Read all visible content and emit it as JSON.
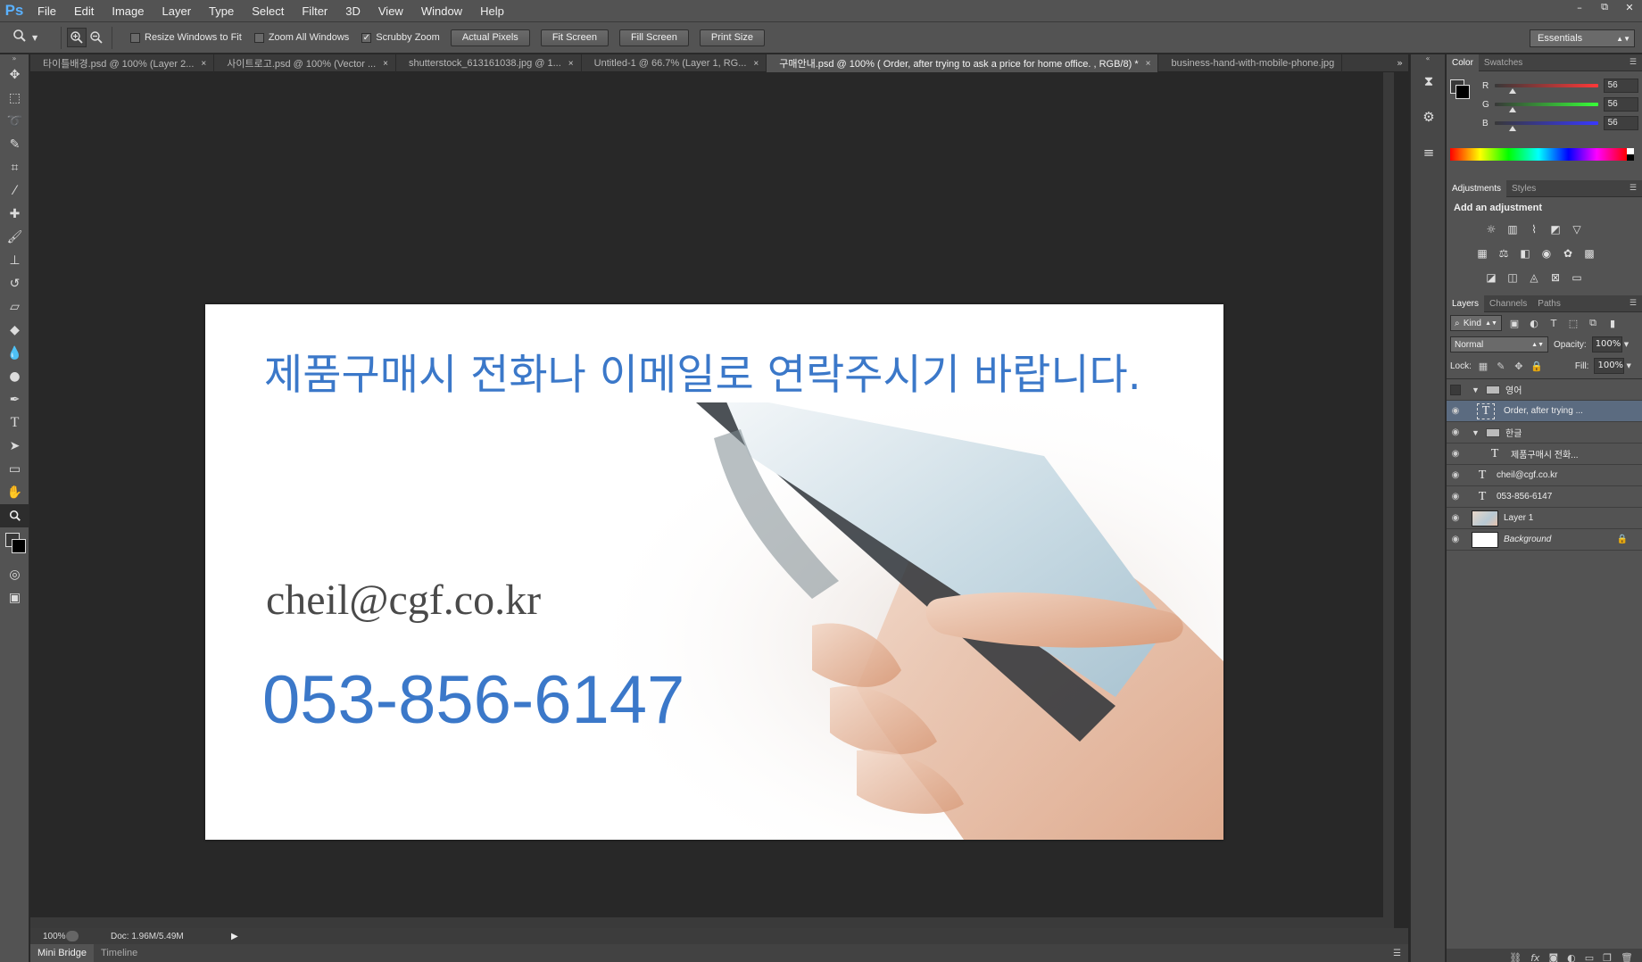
{
  "app": {
    "logo": "Ps"
  },
  "menu": [
    "File",
    "Edit",
    "Image",
    "Layer",
    "Type",
    "Select",
    "Filter",
    "3D",
    "View",
    "Window",
    "Help"
  ],
  "window_controls": [
    "–",
    "⧉",
    "✕"
  ],
  "options": {
    "resize_windows": "Resize Windows to Fit",
    "zoom_all_windows": "Zoom All Windows",
    "scrubby_zoom": "Scrubby Zoom",
    "scrubby_checked": "✓",
    "actual_pixels": "Actual Pixels",
    "fit_screen": "Fit Screen",
    "fill_screen": "Fill Screen",
    "print_size": "Print Size",
    "workspace": "Essentials"
  },
  "tabs": [
    {
      "label": "타이틀배경.psd @ 100% (Layer 2...",
      "close": "×"
    },
    {
      "label": "사이트로고.psd @ 100% (Vector ...",
      "close": "×"
    },
    {
      "label": "shutterstock_613161038.jpg @ 1...",
      "close": "×"
    },
    {
      "label": "Untitled-1 @ 66.7% (Layer 1, RG...",
      "close": "×"
    },
    {
      "label": "구매안내.psd @ 100% ( Order, after trying to ask a price for home office. , RGB/8) *",
      "close": "×"
    },
    {
      "label": "business-hand-with-mobile-phone.jpg",
      "close": ""
    }
  ],
  "tab_overflow": "»",
  "document": {
    "headline": "제품구매시 전화나 이메일로 연락주시기 바랍니다.",
    "email": "cheil@cgf.co.kr",
    "phone": "053-856-6147"
  },
  "status": {
    "zoom": "100%",
    "doc_info": "Doc: 1.96M/5.49M",
    "arrow": "▶"
  },
  "bottom_tabs": [
    "Mini Bridge",
    "Timeline"
  ],
  "color_panel": {
    "tabs": [
      "Color",
      "Swatches"
    ],
    "r_label": "R",
    "g_label": "G",
    "b_label": "B",
    "r": "56",
    "g": "56",
    "b": "56"
  },
  "adjustments": {
    "tabs": [
      "Adjustments",
      "Styles"
    ],
    "title": "Add an adjustment"
  },
  "layers": {
    "tabs": [
      "Layers",
      "Channels",
      "Paths"
    ],
    "filter_kind": "Kind",
    "blend_mode": "Normal",
    "opacity_label": "Opacity:",
    "opacity": "100%",
    "lock_label": "Lock:",
    "fill_label": "Fill:",
    "fill": "100%",
    "items": [
      {
        "name": "영어"
      },
      {
        "name": "Order, after trying ..."
      },
      {
        "name": "한글"
      },
      {
        "name": "제품구매시 전화..."
      },
      {
        "name": "cheil@cgf.co.kr"
      },
      {
        "name": "053-856-6147"
      },
      {
        "name": "Layer 1"
      },
      {
        "name": "Background"
      }
    ]
  }
}
